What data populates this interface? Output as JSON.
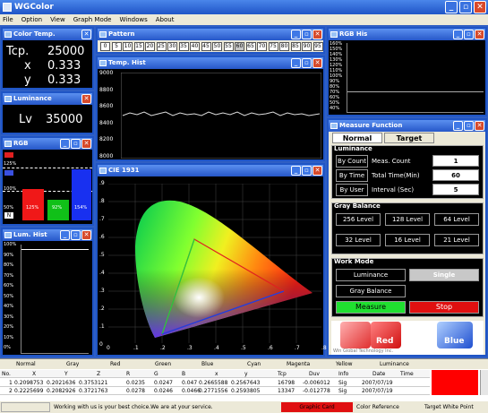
{
  "app": {
    "title": "WGColor"
  },
  "menu": [
    "File",
    "Option",
    "View",
    "Graph Mode",
    "Windows",
    "About"
  ],
  "panels": {
    "color_temp": {
      "title": "Color Temp.",
      "tcp_label": "Tcp.",
      "tcp": "25000",
      "x_label": "x",
      "x": "0.333",
      "y_label": "y",
      "y": "0.333"
    },
    "luminance": {
      "title": "Luminance",
      "lv_label": "Lv",
      "lv": "35000"
    },
    "rgb": {
      "title": "RGB",
      "r_pct": "125%",
      "g_pct": "92%",
      "b_pct": "154%",
      "tick_100": "100%",
      "tick_top": "125%",
      "tick_low": "50%",
      "n_label": "N"
    },
    "lum_hist": {
      "title": "Lum. Hist",
      "ticks": [
        "100%",
        "90%",
        "80%",
        "70%",
        "60%",
        "50%",
        "40%",
        "30%",
        "20%",
        "10%",
        "0%"
      ]
    },
    "pattern": {
      "title": "Pattern",
      "levels": [
        "0",
        "5",
        "10",
        "15",
        "20",
        "25",
        "30",
        "35",
        "40",
        "45",
        "50",
        "55",
        "60",
        "65",
        "70",
        "75",
        "80",
        "85",
        "90",
        "95"
      ]
    },
    "temp_hist": {
      "title": "Temp. Hist",
      "ticks": [
        "9000",
        "8800",
        "8600",
        "8400",
        "8200",
        "8000"
      ]
    },
    "cie": {
      "title": "CIE 1931",
      "yticks": [
        ".9",
        ".8",
        ".7",
        ".6",
        ".5",
        ".4",
        ".3",
        ".2",
        ".1",
        "0"
      ],
      "xticks": [
        "0",
        ".1",
        ".2",
        ".3",
        ".4",
        ".5",
        ".6",
        ".7",
        ".8"
      ]
    },
    "rgb_his": {
      "title": "RGB His",
      "ticks": [
        "160%",
        "150%",
        "140%",
        "130%",
        "120%",
        "110%",
        "100%",
        "90%",
        "80%",
        "70%",
        "60%",
        "50%",
        "40%"
      ]
    },
    "measure": {
      "title": "Measure Function",
      "tab_normal": "Normal",
      "tab_target": "Target",
      "lum_group": "Luminance",
      "by_count": "By Count",
      "by_time": "By Time",
      "by_user": "By User",
      "meas_count_label": "Meas. Count",
      "meas_count": "1",
      "total_time_label": "Total Time(Min)",
      "total_time": "60",
      "interval_label": "Interval (Sec)",
      "interval": "5",
      "gray_group": "Gray Balance",
      "levels": [
        "256 Level",
        "128 Level",
        "64 Level",
        "32 Level",
        "16 Level",
        "21 Level"
      ],
      "work_group": "Work Mode",
      "luminance_btn": "Luminance",
      "single_btn": "Single",
      "gray_balance_btn": "Gray Balance",
      "measure_btn": "Measure",
      "stop_btn": "Stop",
      "logo_red": "Red",
      "logo_blue": "Blue",
      "company": "Win Global Technology Inc."
    }
  },
  "table": {
    "top_headers": [
      "Normal",
      "Gray",
      "Red",
      "Green",
      "Blue",
      "Cyan",
      "Magenta",
      "Yellow",
      "Luminance"
    ],
    "columns": [
      "No.",
      "X",
      "Y",
      "Z",
      "R",
      "G",
      "B",
      "x",
      "y",
      "Tcp",
      "Duv",
      "Info",
      "Date",
      "Time"
    ],
    "rows": [
      [
        "1",
        "0.2098753",
        "0.2021636",
        "0.3753121",
        "0.0235",
        "0.0247",
        "0.047",
        "0.2665588",
        "0.2567643",
        "16798",
        "-0.006012",
        "Sig",
        "2007/07/19",
        ""
      ],
      [
        "2",
        "0.2225699",
        "0.2082926",
        "0.3721763",
        "0.0278",
        "0.0246",
        "0.0466",
        "0.2771556",
        "0.2593805",
        "13347",
        "-0.012778",
        "Sig",
        "2007/07/19",
        ""
      ]
    ]
  },
  "status": {
    "left": "",
    "message": "Working with us is your best choice.We are at your service.",
    "graphic": "Graphic Card",
    "color_ref": "Color Reference",
    "target": "Target White Point"
  }
}
